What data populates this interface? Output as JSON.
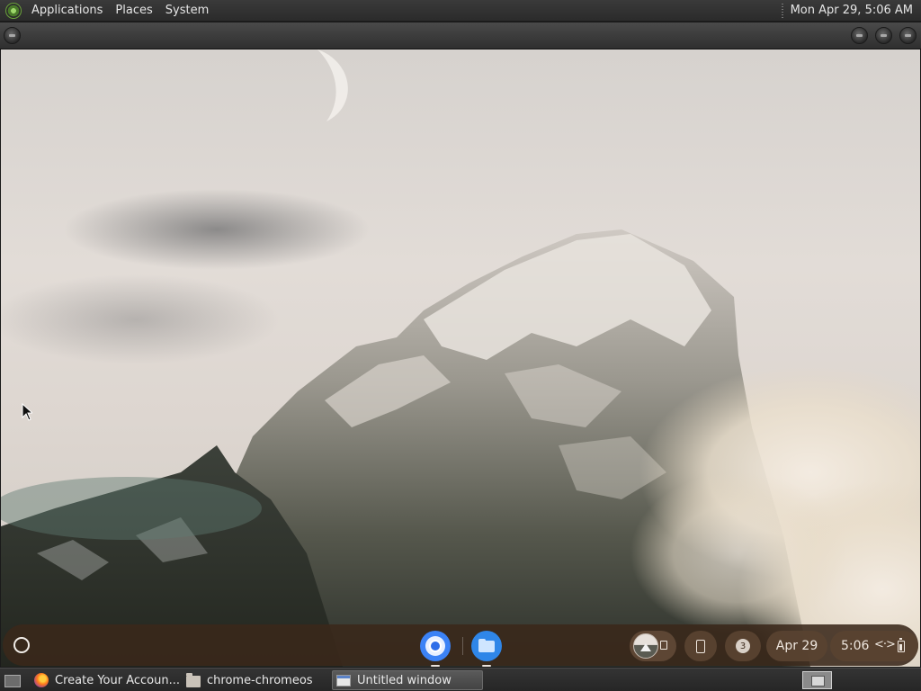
{
  "top_panel": {
    "menus": [
      "Applications",
      "Places",
      "System"
    ],
    "clock": "Mon Apr 29,  5:06 AM"
  },
  "shelf": {
    "pinned_apps": [
      {
        "name": "Chrome",
        "icon": "chrome-icon",
        "active": true
      },
      {
        "name": "Files",
        "icon": "files-icon",
        "active": true
      }
    ],
    "notification_count": "3",
    "date": "Apr 29",
    "time": "5:06",
    "status_icons": [
      "network-arrows-icon",
      "battery-icon"
    ]
  },
  "taskbar": {
    "tasks": [
      {
        "label": "Create Your Accoun...",
        "icon": "firefox-icon",
        "active": false
      },
      {
        "label": "chrome-chromeos",
        "icon": "folder-icon",
        "active": false
      },
      {
        "label": "Untitled window",
        "icon": "window-icon",
        "active": true
      }
    ]
  },
  "colors": {
    "shelf_bg": "#3a281a",
    "chrome_blue": "#3b82f6",
    "files_blue": "#2f86e8"
  }
}
